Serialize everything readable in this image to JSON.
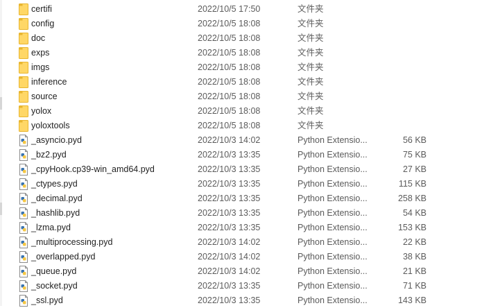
{
  "files": [
    {
      "name": "certifi",
      "date": "2022/10/5 17:50",
      "type": "文件夹",
      "size": "",
      "icon": "folder-icon"
    },
    {
      "name": "config",
      "date": "2022/10/5 18:08",
      "type": "文件夹",
      "size": "",
      "icon": "folder-icon"
    },
    {
      "name": "doc",
      "date": "2022/10/5 18:08",
      "type": "文件夹",
      "size": "",
      "icon": "folder-icon"
    },
    {
      "name": "exps",
      "date": "2022/10/5 18:08",
      "type": "文件夹",
      "size": "",
      "icon": "folder-icon"
    },
    {
      "name": "imgs",
      "date": "2022/10/5 18:08",
      "type": "文件夹",
      "size": "",
      "icon": "folder-icon"
    },
    {
      "name": "inference",
      "date": "2022/10/5 18:08",
      "type": "文件夹",
      "size": "",
      "icon": "folder-icon"
    },
    {
      "name": "source",
      "date": "2022/10/5 18:08",
      "type": "文件夹",
      "size": "",
      "icon": "folder-icon"
    },
    {
      "name": "yolox",
      "date": "2022/10/5 18:08",
      "type": "文件夹",
      "size": "",
      "icon": "folder-icon"
    },
    {
      "name": "yoloxtools",
      "date": "2022/10/5 18:08",
      "type": "文件夹",
      "size": "",
      "icon": "folder-icon"
    },
    {
      "name": "_asyncio.pyd",
      "date": "2022/10/3 14:02",
      "type": "Python Extensio...",
      "size": "56 KB",
      "icon": "python-file-icon"
    },
    {
      "name": "_bz2.pyd",
      "date": "2022/10/3 13:35",
      "type": "Python Extensio...",
      "size": "75 KB",
      "icon": "python-file-icon"
    },
    {
      "name": "_cpyHook.cp39-win_amd64.pyd",
      "date": "2022/10/3 13:35",
      "type": "Python Extensio...",
      "size": "27 KB",
      "icon": "python-file-icon"
    },
    {
      "name": "_ctypes.pyd",
      "date": "2022/10/3 13:35",
      "type": "Python Extensio...",
      "size": "115 KB",
      "icon": "python-file-icon"
    },
    {
      "name": "_decimal.pyd",
      "date": "2022/10/3 13:35",
      "type": "Python Extensio...",
      "size": "258 KB",
      "icon": "python-file-icon"
    },
    {
      "name": "_hashlib.pyd",
      "date": "2022/10/3 13:35",
      "type": "Python Extensio...",
      "size": "54 KB",
      "icon": "python-file-icon"
    },
    {
      "name": "_lzma.pyd",
      "date": "2022/10/3 13:35",
      "type": "Python Extensio...",
      "size": "153 KB",
      "icon": "python-file-icon"
    },
    {
      "name": "_multiprocessing.pyd",
      "date": "2022/10/3 14:02",
      "type": "Python Extensio...",
      "size": "22 KB",
      "icon": "python-file-icon"
    },
    {
      "name": "_overlapped.pyd",
      "date": "2022/10/3 14:02",
      "type": "Python Extensio...",
      "size": "38 KB",
      "icon": "python-file-icon"
    },
    {
      "name": "_queue.pyd",
      "date": "2022/10/3 14:02",
      "type": "Python Extensio...",
      "size": "21 KB",
      "icon": "python-file-icon"
    },
    {
      "name": "_socket.pyd",
      "date": "2022/10/3 13:35",
      "type": "Python Extensio...",
      "size": "71 KB",
      "icon": "python-file-icon"
    },
    {
      "name": "_ssl.pyd",
      "date": "2022/10/3 13:35",
      "type": "Python Extensio...",
      "size": "143 KB",
      "icon": "python-file-icon"
    }
  ],
  "colors": {
    "folder_yellow": "#ffd766",
    "folder_yellow_dark": "#e8b52f",
    "python_blue": "#3a74b0",
    "python_yellow": "#f6c744",
    "secondary_text": "#5b5b5b"
  }
}
